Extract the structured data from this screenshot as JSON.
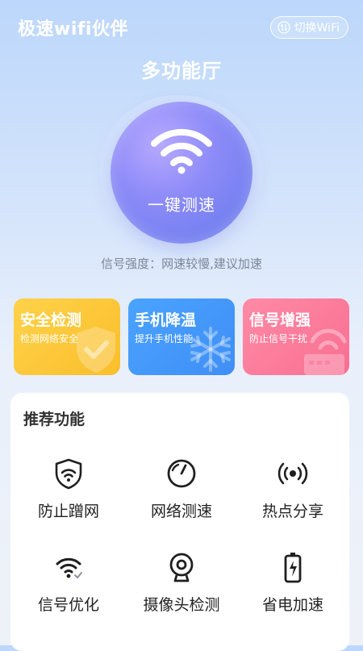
{
  "header": {
    "app_title": "极速wifi伙伴",
    "switch_wifi_label": "切换WiFi"
  },
  "hero": {
    "hall_title": "多功能厅",
    "speed_button_label": "一键测速",
    "signal_text": "信号强度：网速较慢,建议加速"
  },
  "cards": [
    {
      "title": "安全检测",
      "subtitle": "检测网络安全",
      "color": "#f9be2b",
      "icon": "shield-check-icon"
    },
    {
      "title": "手机降温",
      "subtitle": "提升手机性能",
      "color": "#3f8ef5",
      "icon": "snowflake-icon"
    },
    {
      "title": "信号增强",
      "subtitle": "防止信号干扰",
      "color": "#f86f92",
      "icon": "router-icon"
    }
  ],
  "recommend": {
    "title": "推荐功能",
    "items": [
      {
        "label": "防止蹭网",
        "icon": "shield-wifi-icon"
      },
      {
        "label": "网络测速",
        "icon": "speedometer-icon"
      },
      {
        "label": "热点分享",
        "icon": "hotspot-icon"
      },
      {
        "label": "信号优化",
        "icon": "wifi-check-icon"
      },
      {
        "label": "摄像头检测",
        "icon": "camera-icon"
      },
      {
        "label": "省电加速",
        "icon": "battery-icon"
      }
    ]
  }
}
